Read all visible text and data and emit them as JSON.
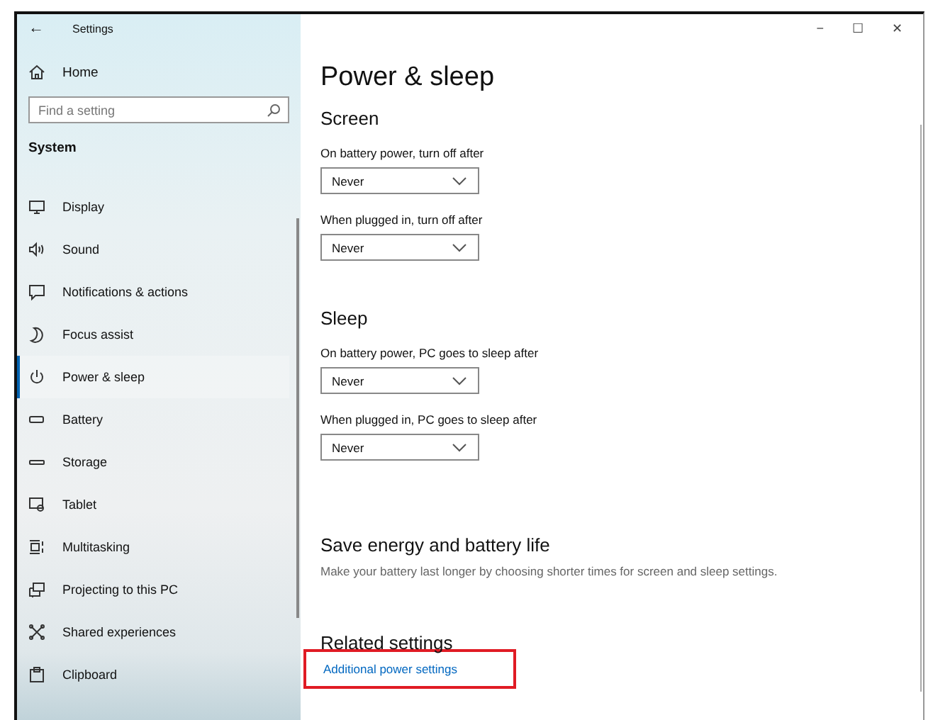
{
  "window": {
    "title": "Settings",
    "back": "←",
    "controls": [
      "−",
      "☐",
      "✕"
    ]
  },
  "sidebar": {
    "home": "Home",
    "search": {
      "placeholder": "Find a setting"
    },
    "section": "System",
    "items": [
      {
        "label": "Display",
        "selected": false
      },
      {
        "label": "Sound",
        "selected": false
      },
      {
        "label": "Notifications & actions",
        "selected": false
      },
      {
        "label": "Focus assist",
        "selected": false
      },
      {
        "label": "Power & sleep",
        "selected": true
      },
      {
        "label": "Battery",
        "selected": false
      },
      {
        "label": "Storage",
        "selected": false
      },
      {
        "label": "Tablet",
        "selected": false
      },
      {
        "label": "Multitasking",
        "selected": false
      },
      {
        "label": "Projecting to this PC",
        "selected": false
      },
      {
        "label": "Shared experiences",
        "selected": false
      },
      {
        "label": "Clipboard",
        "selected": false
      }
    ]
  },
  "page": {
    "title": "Power & sleep",
    "sections": [
      {
        "heading": "Screen",
        "settings": [
          {
            "label": "On battery power, turn off after",
            "value": "Never"
          },
          {
            "label": "When plugged in, turn off after",
            "value": "Never"
          }
        ]
      },
      {
        "heading": "Sleep",
        "settings": [
          {
            "label": "On battery power, PC goes to sleep after",
            "value": "Never"
          },
          {
            "label": "When plugged in, PC goes to sleep after",
            "value": "Never"
          }
        ]
      }
    ],
    "save_energy": {
      "heading": "Save energy and battery life",
      "text": "Make your battery last longer by choosing shorter times for screen and sleep settings."
    },
    "related": {
      "heading": "Related settings",
      "link": "Additional power settings",
      "highlighted": true
    }
  }
}
